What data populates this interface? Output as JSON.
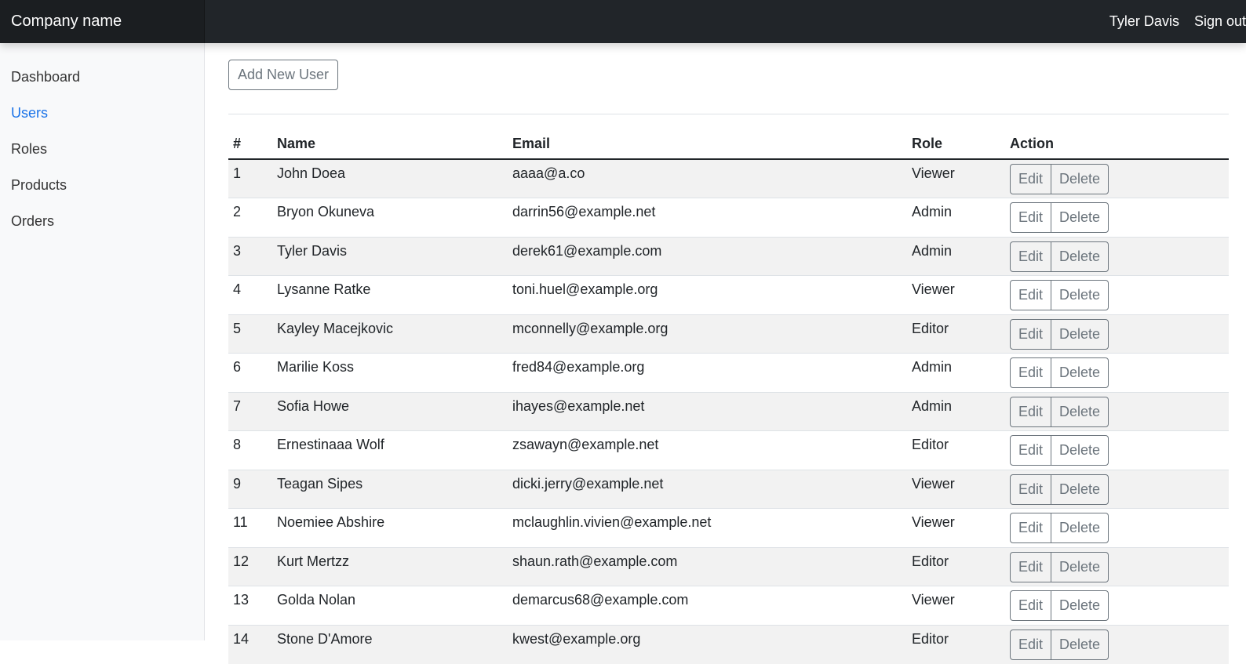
{
  "header": {
    "brand": "Company name",
    "user_name": "Tyler Davis",
    "sign_out": "Sign out"
  },
  "sidebar": {
    "items": [
      {
        "label": "Dashboard"
      },
      {
        "label": "Users",
        "active": true
      },
      {
        "label": "Roles"
      },
      {
        "label": "Products"
      },
      {
        "label": "Orders"
      }
    ]
  },
  "toolbar": {
    "add_user_label": "Add New User"
  },
  "table": {
    "headers": [
      "#",
      "Name",
      "Email",
      "Role",
      "Action"
    ],
    "action_labels": {
      "edit": "Edit",
      "delete": "Delete"
    },
    "rows": [
      {
        "id": "1",
        "name": "John Doea",
        "email": "aaaa@a.co",
        "role": "Viewer"
      },
      {
        "id": "2",
        "name": "Bryon Okuneva",
        "email": "darrin56@example.net",
        "role": "Admin"
      },
      {
        "id": "3",
        "name": "Tyler Davis",
        "email": "derek61@example.com",
        "role": "Admin"
      },
      {
        "id": "4",
        "name": "Lysanne Ratke",
        "email": "toni.huel@example.org",
        "role": "Viewer"
      },
      {
        "id": "5",
        "name": "Kayley Macejkovic",
        "email": "mconnelly@example.org",
        "role": "Editor"
      },
      {
        "id": "6",
        "name": "Marilie Koss",
        "email": "fred84@example.org",
        "role": "Admin"
      },
      {
        "id": "7",
        "name": "Sofia Howe",
        "email": "ihayes@example.net",
        "role": "Admin"
      },
      {
        "id": "8",
        "name": "Ernestinaaa Wolf",
        "email": "zsawayn@example.net",
        "role": "Editor"
      },
      {
        "id": "9",
        "name": "Teagan Sipes",
        "email": "dicki.jerry@example.net",
        "role": "Viewer"
      },
      {
        "id": "11",
        "name": "Noemiee Abshire",
        "email": "mclaughlin.vivien@example.net",
        "role": "Viewer"
      },
      {
        "id": "12",
        "name": "Kurt Mertzz",
        "email": "shaun.rath@example.com",
        "role": "Editor"
      },
      {
        "id": "13",
        "name": "Golda Nolan",
        "email": "demarcus68@example.com",
        "role": "Viewer"
      },
      {
        "id": "14",
        "name": "Stone D'Amore",
        "email": "kwest@example.org",
        "role": "Editor"
      }
    ]
  },
  "colors": {
    "topbar": "#212529",
    "sidebar": "#f8f9fa",
    "active_link": "#1a73e8",
    "button_outline": "#6c757d",
    "striped_row": "#f2f2f2"
  }
}
